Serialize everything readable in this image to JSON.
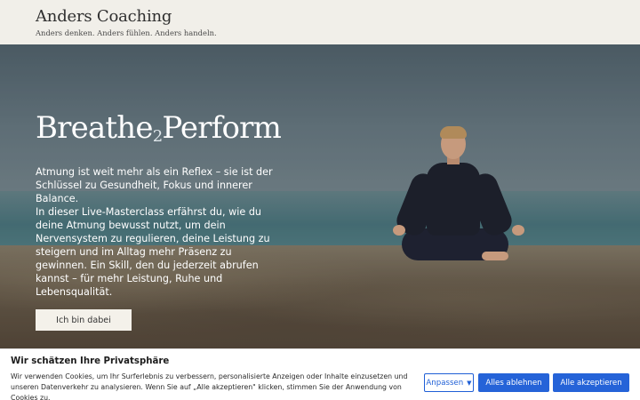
{
  "header": {
    "brand_name": "Anders Coaching",
    "tagline": "Anders denken. Anders fühlen. Anders handeln."
  },
  "hero": {
    "title_part1": "Breathe",
    "title_part2": "2",
    "title_part3": "Perform",
    "paragraph1": "Atmung ist weit mehr als ein Reflex – sie ist der Schlüssel zu Gesundheit, Fokus und innerer Balance.",
    "paragraph2": "In dieser Live-Masterclass erfährst du, wie du deine Atmung bewusst nutzt, um dein Nervensystem zu regulieren, deine Leistung zu steigern und im Alltag mehr Präsenz zu gewinnen. Ein Skill, den du jederzeit abrufen kannst – für mehr Leistung, Ruhe und Lebensqualität.",
    "cta_label": "Ich bin dabei"
  },
  "cookie_banner": {
    "title": "Wir schätzen Ihre Privatsphäre",
    "text": "Wir verwenden Cookies, um Ihr Surferlebnis zu verbessern, personalisierte Anzeigen oder Inhalte einzusetzen und unseren Datenverkehr zu analysieren. Wenn Sie auf „Alle akzeptieren\" klicken, stimmen Sie der Anwendung von Cookies zu.",
    "customize_label": "Anpassen",
    "reject_label": "Alles ablehnen",
    "accept_label": "Alle akzeptieren",
    "accent_color": "#2563d8"
  }
}
